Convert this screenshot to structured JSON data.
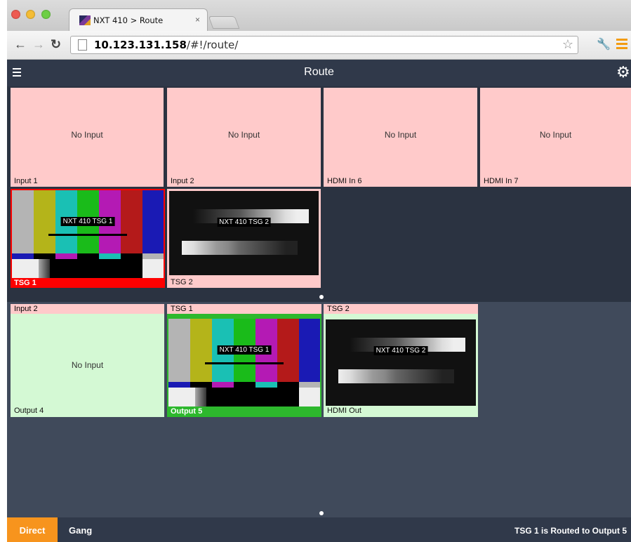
{
  "browser": {
    "tab_title": "NXT 410 > Route",
    "tab_close": "×",
    "url_host": "10.123.131.158",
    "url_path": "/#!/route/"
  },
  "header": {
    "title": "Route"
  },
  "inputs": [
    {
      "label": "Input 1",
      "status": "No Input"
    },
    {
      "label": "Input 2",
      "status": "No Input"
    },
    {
      "label": "HDMI In 6",
      "status": "No Input"
    },
    {
      "label": "HDMI In 7",
      "status": "No Input"
    },
    {
      "label": "TSG 1",
      "overlay": "NXT 410 TSG 1",
      "selected": true
    },
    {
      "label": "TSG 2",
      "overlay": "NXT 410 TSG 2"
    }
  ],
  "outputs": [
    {
      "source": "Input 2",
      "label": "Output 4",
      "status": "No Input"
    },
    {
      "source": "TSG 1",
      "label": "Output 5",
      "overlay": "NXT 410 TSG 1",
      "selected": true
    },
    {
      "source": "TSG 2",
      "label": "HDMI Out",
      "overlay": "NXT 410 TSG 2"
    }
  ],
  "footer": {
    "direct_label": "Direct",
    "gang_label": "Gang",
    "status": "TSG 1 is Routed to Output 5"
  },
  "colors": {
    "header_bg": "#30394a",
    "no_input_pink": "#ffcaca",
    "output_green": "#d4f9d4",
    "selected_input": "#ff0000",
    "selected_output": "#2db82d",
    "accent_orange": "#f7941d"
  }
}
